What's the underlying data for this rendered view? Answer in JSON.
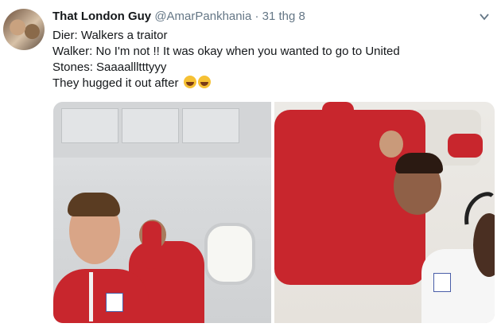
{
  "tweet": {
    "display_name": "That London Guy",
    "handle": "@AmarPankhania",
    "separator": "·",
    "date": "31 thg 8",
    "lines": [
      "Dier: Walkers a traitor",
      "Walker: No I'm not !! It was okay when you wanted to go to United",
      "Stones: Saaaallltttyyy",
      "They hugged it out after"
    ],
    "emojis": [
      "face-with-tears-of-joy",
      "face-with-tears-of-joy"
    ]
  },
  "colors": {
    "text": "#14171a",
    "secondary_text": "#657786",
    "jacket_red": "#c8262d"
  },
  "icons": {
    "menu": "chevron-down-icon"
  }
}
